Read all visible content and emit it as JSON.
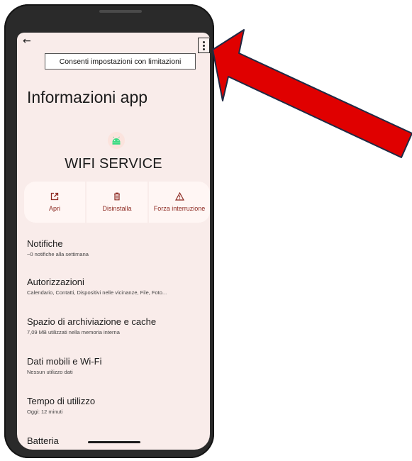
{
  "topbar": {
    "menu_item": "Consenti impostazioni con limitazioni"
  },
  "page_title": "Informazioni app",
  "app": {
    "name": "WIFI SERVICE"
  },
  "actions": [
    {
      "label": "Apri",
      "icon": "open-in-new-icon"
    },
    {
      "label": "Disinstalla",
      "icon": "trash-icon"
    },
    {
      "label": "Forza interruzione",
      "icon": "warning-icon"
    }
  ],
  "settings": [
    {
      "title": "Notifiche",
      "subtitle": "~0 notifiche alla settimana"
    },
    {
      "title": "Autorizzazioni",
      "subtitle": "Calendario, Contatti, Dispositivi nelle vicinanze, File, Foto..."
    },
    {
      "title": "Spazio di archiviazione e cache",
      "subtitle": "7,09 MB utilizzati nella memoria interna"
    },
    {
      "title": "Dati mobili e Wi-Fi",
      "subtitle": "Nessun utilizzo dati"
    },
    {
      "title": "Tempo di utilizzo",
      "subtitle": "Oggi: 12 minuti"
    },
    {
      "title": "Batteria",
      "subtitle": ""
    }
  ],
  "colors": {
    "screen_bg": "#f9ecea",
    "accent": "#8d2a22",
    "android_green": "#3ddc84",
    "annotation_arrow": "#e00000"
  }
}
